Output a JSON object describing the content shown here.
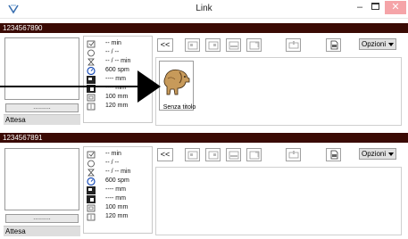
{
  "window": {
    "title": "Link",
    "min_glyph": "–",
    "close_glyph": "✕"
  },
  "jobs": [
    {
      "id": "1234567890",
      "left_button_label": "..........",
      "status": "Attesa",
      "info": [
        "-- min",
        "-- / --",
        "-- / -- min",
        "600 spm",
        "---- mm",
        "---- mm",
        "100 mm",
        "120 mm"
      ],
      "thumbnail_label": "Senza titolo",
      "options_label": "Opzioni",
      "back_label": "<<"
    },
    {
      "id": "1234567891",
      "left_button_label": "..........",
      "status": "Attesa",
      "info": [
        "-- min",
        "-- / --",
        "-- / -- min",
        "600 spm",
        "---- mm",
        "---- mm",
        "100 mm",
        "120 mm"
      ],
      "options_label": "Opzioni",
      "back_label": "<<"
    }
  ]
}
